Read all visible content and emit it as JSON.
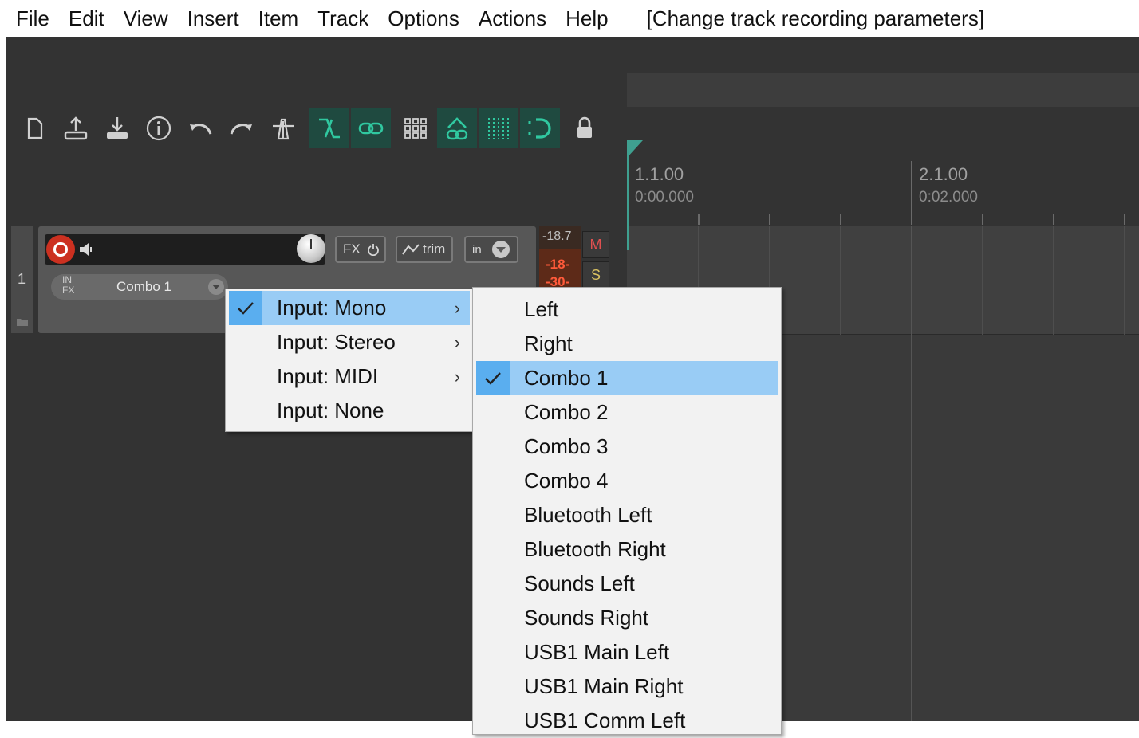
{
  "menubar": {
    "items": [
      "File",
      "Edit",
      "View",
      "Insert",
      "Item",
      "Track",
      "Options",
      "Actions",
      "Help"
    ],
    "status": "[Change track recording parameters]"
  },
  "toolbar": {
    "buttons": [
      {
        "icon": "new-project-icon",
        "active": false
      },
      {
        "icon": "open-project-icon",
        "active": false
      },
      {
        "icon": "save-project-icon",
        "active": false
      },
      {
        "icon": "project-settings-icon",
        "active": false
      },
      {
        "icon": "undo-icon",
        "active": false
      },
      {
        "icon": "redo-icon",
        "active": false
      },
      {
        "icon": "metronome-icon",
        "active": false
      },
      {
        "icon": "ripple-edit-icon",
        "active": true
      },
      {
        "icon": "grouping-link-icon",
        "active": true
      },
      {
        "icon": "grid-icon",
        "active": false
      },
      {
        "icon": "envelope-link-icon",
        "active": true
      },
      {
        "icon": "snap-grid-icon",
        "active": true
      },
      {
        "icon": "auto-crossfade-icon",
        "active": true
      },
      {
        "icon": "lock-icon",
        "active": false
      }
    ],
    "accent": "#1f4a40",
    "accent_fg": "#30c8a0"
  },
  "timeline": {
    "markers": [
      {
        "measure": "1.1.00",
        "time": "0:00.000"
      },
      {
        "measure": "2.1.00",
        "time": "0:02.000"
      }
    ]
  },
  "track": {
    "number": "1",
    "input_fx": "IN FX",
    "input_name": "Combo 1",
    "fx_label": "FX",
    "trim_label": "trim",
    "in_label": "in",
    "meter_peak": "-18.7",
    "meter_scale_1": "-18-",
    "meter_scale_2": "-30-",
    "mute_label": "M",
    "solo_label": "S",
    "record_color": "#cc3020"
  },
  "input_menu": {
    "items": [
      {
        "label": "Input: Mono",
        "checked": true,
        "submenu": true,
        "highlighted": true
      },
      {
        "label": "Input: Stereo",
        "checked": false,
        "submenu": true,
        "highlighted": false
      },
      {
        "label": "Input: MIDI",
        "checked": false,
        "submenu": true,
        "highlighted": false
      },
      {
        "label": "Input: None",
        "checked": false,
        "submenu": false,
        "highlighted": false
      }
    ]
  },
  "mono_submenu": {
    "items": [
      {
        "label": "Left",
        "checked": false,
        "highlighted": false
      },
      {
        "label": "Right",
        "checked": false,
        "highlighted": false
      },
      {
        "label": "Combo 1",
        "checked": true,
        "highlighted": true
      },
      {
        "label": "Combo 2",
        "checked": false,
        "highlighted": false
      },
      {
        "label": "Combo 3",
        "checked": false,
        "highlighted": false
      },
      {
        "label": "Combo 4",
        "checked": false,
        "highlighted": false
      },
      {
        "label": "Bluetooth Left",
        "checked": false,
        "highlighted": false
      },
      {
        "label": "Bluetooth Right",
        "checked": false,
        "highlighted": false
      },
      {
        "label": "Sounds Left",
        "checked": false,
        "highlighted": false
      },
      {
        "label": "Sounds Right",
        "checked": false,
        "highlighted": false
      },
      {
        "label": "USB1 Main Left",
        "checked": false,
        "highlighted": false
      },
      {
        "label": "USB1 Main Right",
        "checked": false,
        "highlighted": false
      },
      {
        "label": "USB1 Comm Left",
        "checked": false,
        "highlighted": false
      }
    ],
    "highlight_color": "#99ccf5"
  }
}
